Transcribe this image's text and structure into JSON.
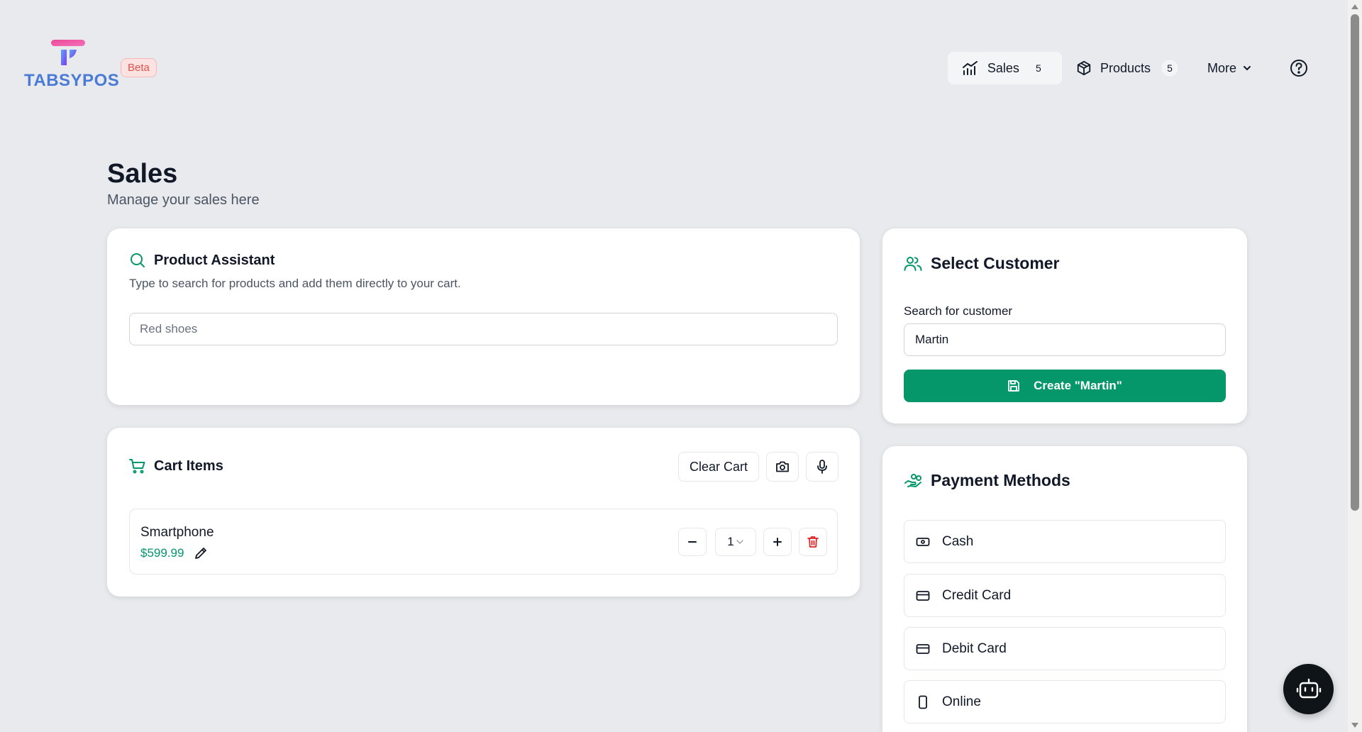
{
  "app": {
    "logo_text": "TABSYPOS",
    "beta_label": "Beta"
  },
  "nav": {
    "sales": {
      "label": "Sales",
      "count": "5",
      "icon": "chart-icon"
    },
    "products": {
      "label": "Products",
      "count": "5",
      "icon": "box-icon"
    },
    "more": {
      "label": "More",
      "icon": "chevron-down-icon"
    },
    "help_icon": "help-circle-icon"
  },
  "page": {
    "title": "Sales",
    "subtitle": "Manage your sales here"
  },
  "product_assistant": {
    "title": "Product Assistant",
    "description": "Type to search for products and add them directly to your cart.",
    "placeholder": "Red shoes"
  },
  "cart": {
    "title": "Cart Items",
    "clear_label": "Clear Cart",
    "items": [
      {
        "name": "Smartphone",
        "price": "$599.99",
        "quantity": "1"
      }
    ]
  },
  "customer": {
    "title": "Select Customer",
    "search_label": "Search for customer",
    "search_value": "Martin",
    "create_label": "Create \"Martin\""
  },
  "payment": {
    "title": "Payment Methods",
    "methods": [
      {
        "label": "Cash",
        "icon": "cash-icon"
      },
      {
        "label": "Credit Card",
        "icon": "credit-card-icon"
      },
      {
        "label": "Debit Card",
        "icon": "debit-card-icon"
      },
      {
        "label": "Online",
        "icon": "smartphone-icon"
      }
    ]
  },
  "colors": {
    "accent_green": "#059669",
    "background": "#e8eaed",
    "danger": "#dc2626",
    "logo_pink": "#ec4899",
    "logo_blue": "#4a7bd6"
  }
}
